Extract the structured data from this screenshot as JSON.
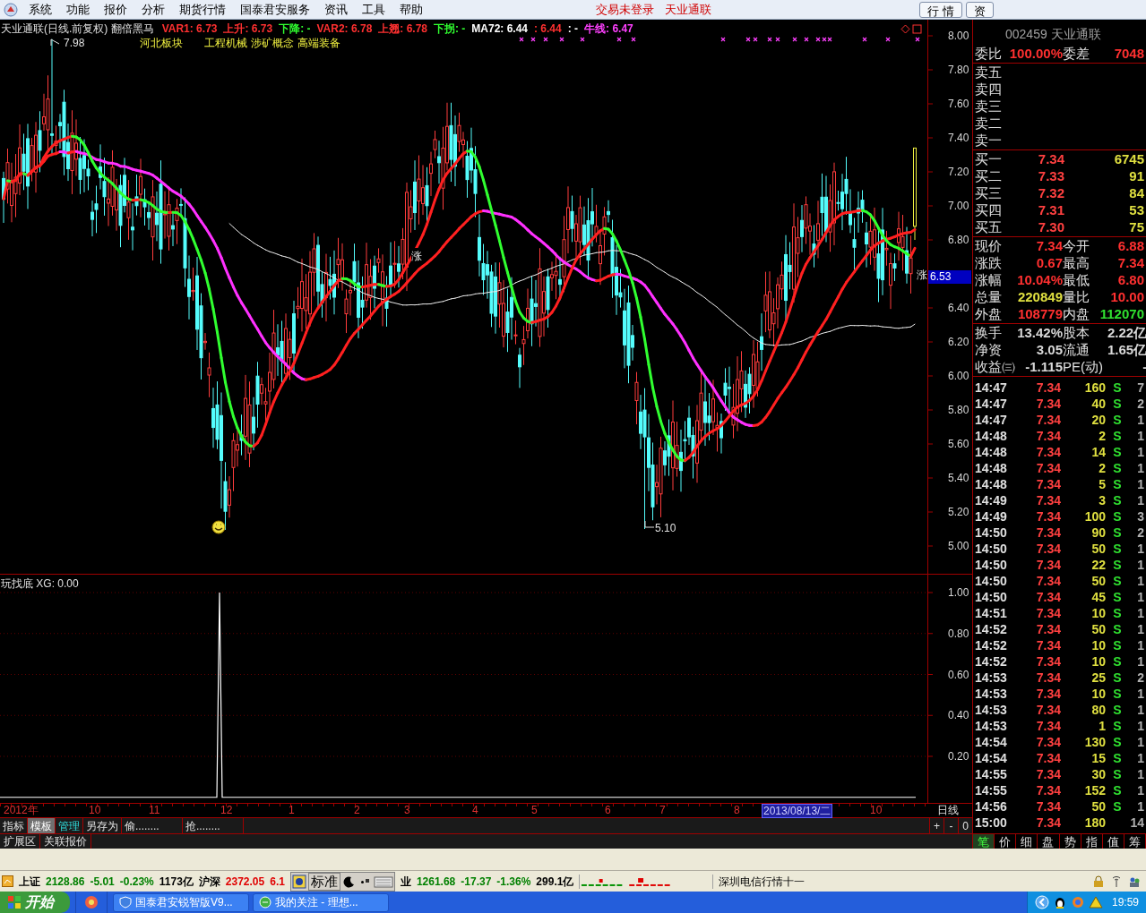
{
  "menu_bar": {
    "items": [
      "系统",
      "功能",
      "报价",
      "分析",
      "期货行情",
      "国泰君安服务",
      "资讯",
      "工具",
      "帮助"
    ],
    "notices": [
      "交易未登录",
      "天业通联"
    ],
    "buttons": [
      "行 情",
      "资"
    ]
  },
  "price_chart": {
    "title": "天业通联(日线.前复权) 翻倍黑马",
    "indicators": [
      {
        "text": "VAR1: 6.73",
        "color": "#ff3030"
      },
      {
        "text": "上升: 6.73",
        "color": "#ff3030"
      },
      {
        "text": "下降: -",
        "color": "#30ff30"
      },
      {
        "text": "VAR2: 6.78",
        "color": "#ff3030"
      },
      {
        "text": "上翘: 6.78",
        "color": "#ff3030"
      },
      {
        "text": "下拐: -",
        "color": "#30ff30"
      },
      {
        "text": "MA72: 6.44",
        "color": "#ffffff"
      },
      {
        "text": ": 6.44",
        "color": "#ff3030"
      },
      {
        "text": ": -",
        "color": "#ffffff"
      },
      {
        "text": "牛线: 6.47",
        "color": "#ff40ff"
      }
    ],
    "tags": [
      "河北板块",
      "工程机械",
      "涉矿概念",
      "高端装备"
    ],
    "high_label": "7.98",
    "low_label": "5.10",
    "rise_marks": [
      "涨",
      "涨"
    ],
    "y_ticks": [
      "8.00",
      "7.80",
      "7.60",
      "7.40",
      "7.20",
      "7.00",
      "6.80",
      "6.40",
      "6.20",
      "6.00",
      "5.80",
      "5.60",
      "5.40",
      "5.20",
      "5.00"
    ],
    "price_tag": "6.53"
  },
  "indicator_chart": {
    "title": "玩找底 XG: 0.00",
    "y_ticks": [
      "1.00",
      "0.80",
      "0.60",
      "0.40",
      "0.20"
    ]
  },
  "x_axis": {
    "labels": [
      {
        "label": "2012年",
        "selected": false
      },
      {
        "label": "10",
        "selected": false
      },
      {
        "label": "11",
        "selected": false
      },
      {
        "label": "12",
        "selected": false
      },
      {
        "label": "1",
        "selected": false
      },
      {
        "label": "2",
        "selected": false
      },
      {
        "label": "3",
        "selected": false
      },
      {
        "label": "4",
        "selected": false
      },
      {
        "label": "5",
        "selected": false
      },
      {
        "label": "6",
        "selected": false
      },
      {
        "label": "7",
        "selected": false
      },
      {
        "label": "8",
        "selected": false
      },
      {
        "label": "2013/08/13/二",
        "selected": true
      },
      {
        "label": "10",
        "selected": false
      }
    ],
    "period": "日线"
  },
  "toolbar": {
    "items": [
      {
        "label": "指标",
        "kind": "plain"
      },
      {
        "label": "模板",
        "kind": "pressed"
      },
      {
        "label": "管理",
        "kind": "accent"
      },
      {
        "label": "另存为",
        "kind": "plain"
      },
      {
        "label": "偷........",
        "kind": "plain"
      },
      {
        "label": "抢........",
        "kind": "plain"
      }
    ],
    "zoom_buttons": [
      "+",
      "-",
      "0"
    ]
  },
  "bottom_tabs": [
    "扩展区",
    "关联报价"
  ],
  "quote_panel": {
    "title": "002459 天业通联",
    "ratio": [
      {
        "label": "委比",
        "value": "100.00%",
        "color": "#ff3030"
      },
      {
        "label": "委差",
        "value": "7048",
        "color": "#ff3030"
      }
    ],
    "asks": [
      "卖五",
      "卖四",
      "卖三",
      "卖二",
      "卖一"
    ],
    "bids": [
      {
        "label": "买一",
        "price": "7.34",
        "volume": "6745"
      },
      {
        "label": "买二",
        "price": "7.33",
        "volume": "91"
      },
      {
        "label": "买三",
        "price": "7.32",
        "volume": "84"
      },
      {
        "label": "买四",
        "price": "7.31",
        "volume": "53"
      },
      {
        "label": "买五",
        "price": "7.30",
        "volume": "75"
      }
    ],
    "stats": [
      {
        "label": "现价",
        "value": "7.34",
        "color": "#ff3030"
      },
      {
        "label": "今开",
        "value": "6.88",
        "color": "#ff3030"
      },
      {
        "label": "涨跌",
        "value": "0.67",
        "color": "#ff3030"
      },
      {
        "label": "最高",
        "value": "7.34",
        "color": "#ff3030"
      },
      {
        "label": "涨幅",
        "value": "10.04%",
        "color": "#ff3030"
      },
      {
        "label": "最低",
        "value": "6.80",
        "color": "#ff3030"
      },
      {
        "label": "总量",
        "value": "220849",
        "color": "#e0e040"
      },
      {
        "label": "量比",
        "value": "10.00",
        "color": "#ff3030"
      },
      {
        "label": "外盘",
        "value": "108779",
        "color": "#ff3030"
      },
      {
        "label": "内盘",
        "value": "112070",
        "color": "#30e030"
      }
    ],
    "fundamentals": [
      {
        "label": "换手",
        "value": "13.42%"
      },
      {
        "label": "股本",
        "value": "2.22亿"
      },
      {
        "label": "净资",
        "value": "3.05"
      },
      {
        "label": "流通",
        "value": "1.65亿"
      },
      {
        "label": "收益㈢",
        "value": "-1.115"
      },
      {
        "label": "PE(动)",
        "value": "-"
      }
    ],
    "trades": [
      {
        "time": "14:47",
        "price": "7.34",
        "volume": "160",
        "side": "S",
        "count": "7"
      },
      {
        "time": "14:47",
        "price": "7.34",
        "volume": "40",
        "side": "S",
        "count": "2"
      },
      {
        "time": "14:47",
        "price": "7.34",
        "volume": "20",
        "side": "S",
        "count": "1"
      },
      {
        "time": "14:48",
        "price": "7.34",
        "volume": "2",
        "side": "S",
        "count": "1"
      },
      {
        "time": "14:48",
        "price": "7.34",
        "volume": "14",
        "side": "S",
        "count": "1"
      },
      {
        "time": "14:48",
        "price": "7.34",
        "volume": "2",
        "side": "S",
        "count": "1"
      },
      {
        "time": "14:48",
        "price": "7.34",
        "volume": "5",
        "side": "S",
        "count": "1"
      },
      {
        "time": "14:49",
        "price": "7.34",
        "volume": "3",
        "side": "S",
        "count": "1"
      },
      {
        "time": "14:49",
        "price": "7.34",
        "volume": "100",
        "side": "S",
        "count": "3"
      },
      {
        "time": "14:50",
        "price": "7.34",
        "volume": "90",
        "side": "S",
        "count": "2"
      },
      {
        "time": "14:50",
        "price": "7.34",
        "volume": "50",
        "side": "S",
        "count": "1"
      },
      {
        "time": "14:50",
        "price": "7.34",
        "volume": "22",
        "side": "S",
        "count": "1"
      },
      {
        "time": "14:50",
        "price": "7.34",
        "volume": "50",
        "side": "S",
        "count": "1"
      },
      {
        "time": "14:50",
        "price": "7.34",
        "volume": "45",
        "side": "S",
        "count": "1"
      },
      {
        "time": "14:51",
        "price": "7.34",
        "volume": "10",
        "side": "S",
        "count": "1"
      },
      {
        "time": "14:52",
        "price": "7.34",
        "volume": "50",
        "side": "S",
        "count": "1"
      },
      {
        "time": "14:52",
        "price": "7.34",
        "volume": "10",
        "side": "S",
        "count": "1"
      },
      {
        "time": "14:52",
        "price": "7.34",
        "volume": "10",
        "side": "S",
        "count": "1"
      },
      {
        "time": "14:53",
        "price": "7.34",
        "volume": "25",
        "side": "S",
        "count": "2"
      },
      {
        "time": "14:53",
        "price": "7.34",
        "volume": "10",
        "side": "S",
        "count": "1"
      },
      {
        "time": "14:53",
        "price": "7.34",
        "volume": "80",
        "side": "S",
        "count": "1"
      },
      {
        "time": "14:53",
        "price": "7.34",
        "volume": "1",
        "side": "S",
        "count": "1"
      },
      {
        "time": "14:54",
        "price": "7.34",
        "volume": "130",
        "side": "S",
        "count": "1"
      },
      {
        "time": "14:54",
        "price": "7.34",
        "volume": "15",
        "side": "S",
        "count": "1"
      },
      {
        "time": "14:55",
        "price": "7.34",
        "volume": "30",
        "side": "S",
        "count": "1"
      },
      {
        "time": "14:55",
        "price": "7.34",
        "volume": "152",
        "side": "S",
        "count": "1"
      },
      {
        "time": "14:56",
        "price": "7.34",
        "volume": "50",
        "side": "S",
        "count": "1"
      },
      {
        "time": "15:00",
        "price": "7.34",
        "volume": "180",
        "count": "14"
      }
    ],
    "tabs": [
      {
        "label": "笔",
        "selected": true
      },
      {
        "label": "价",
        "selected": false
      },
      {
        "label": "细",
        "selected": false
      },
      {
        "label": "盘",
        "selected": false
      },
      {
        "label": "势",
        "selected": false
      },
      {
        "label": "指",
        "selected": false
      },
      {
        "label": "值",
        "selected": false
      },
      {
        "label": "筹",
        "selected": false
      }
    ]
  },
  "status_bar": {
    "left_quotes": [
      {
        "text": "上证",
        "color": "#000000"
      },
      {
        "text": "2128.86",
        "color": "#008000"
      },
      {
        "text": "-5.01",
        "color": "#008000"
      },
      {
        "text": "-0.23%",
        "color": "#008000"
      },
      {
        "text": "1173亿",
        "color": "#000000"
      },
      {
        "text": "沪深",
        "color": "#000000"
      },
      {
        "text": "2372.05",
        "color": "#e00000"
      },
      {
        "text": "6.1",
        "color": "#e00000"
      }
    ],
    "ime_label": "标准",
    "right_quotes": [
      {
        "text": "业",
        "color": "#000000"
      },
      {
        "text": "1261.68",
        "color": "#008000"
      },
      {
        "text": "-17.37",
        "color": "#008000"
      },
      {
        "text": "-1.36%",
        "color": "#008000"
      },
      {
        "text": "299.1亿",
        "color": "#000000"
      }
    ],
    "ticker": "深圳电信行情十一"
  },
  "taskbar": {
    "start": "开始",
    "tasks": [
      "国泰君安锐智版V9...",
      "我的关注 - 理想..."
    ],
    "clock": "19:59"
  }
}
